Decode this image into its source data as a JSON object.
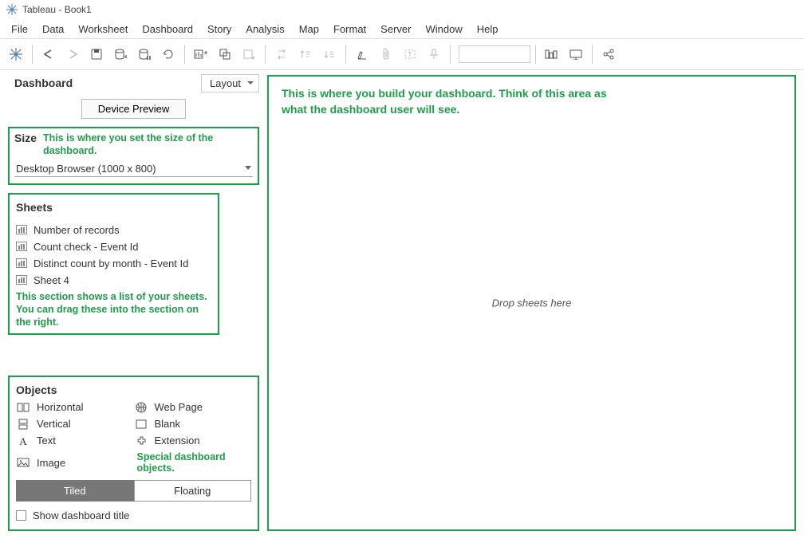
{
  "window": {
    "title": "Tableau - Book1"
  },
  "menu": [
    "File",
    "Data",
    "Worksheet",
    "Dashboard",
    "Story",
    "Analysis",
    "Map",
    "Format",
    "Server",
    "Window",
    "Help"
  ],
  "sidebar": {
    "tab_active": "Dashboard",
    "layout_label": "Layout",
    "device_preview": "Device Preview",
    "size": {
      "label": "Size",
      "annotation": "This is where you set the size of the dashboard.",
      "value": "Desktop Browser (1000 x 800)"
    },
    "sheets": {
      "label": "Sheets",
      "items": [
        "Number of records",
        "Count check - Event Id",
        "Distinct count by month - Event Id",
        "Sheet 4"
      ],
      "annotation": "This section shows a list of your sheets. You can drag these into the section on the right."
    },
    "objects": {
      "label": "Objects",
      "items_left": [
        "Horizontal",
        "Vertical",
        "Text",
        "Image"
      ],
      "items_right": [
        "Web Page",
        "Blank",
        "Extension"
      ],
      "annotation": "Special dashboard objects.",
      "tiled": "Tiled",
      "floating": "Floating",
      "show_title": "Show dashboard title"
    }
  },
  "canvas": {
    "annotation": "This is where you build your dashboard. Think of this area as what the dashboard user will see.",
    "placeholder": "Drop sheets here"
  }
}
